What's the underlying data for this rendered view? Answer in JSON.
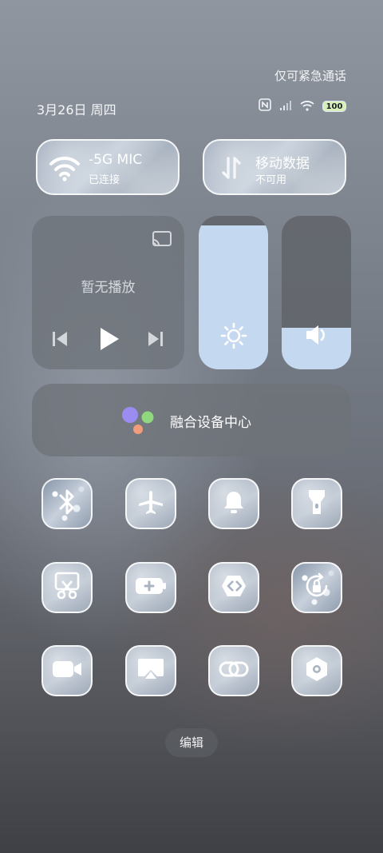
{
  "status_bar": {
    "emergency_text": "仅可紧急通话",
    "date_text": "3月26日 周四",
    "battery_level": "100",
    "icons": [
      "nfc-icon",
      "signal-icon",
      "wifi-icon",
      "battery-icon"
    ]
  },
  "connectivity": {
    "wifi": {
      "title": "-5G   MIC",
      "subtitle": "已连接",
      "icon": "wifi-icon"
    },
    "mobile_data": {
      "title": "移动数据",
      "subtitle": "不可用",
      "icon": "mobile-data-icon"
    }
  },
  "media": {
    "status_text": "暂无播放",
    "icons": [
      "cast-icon",
      "previous-icon",
      "play-icon",
      "next-icon"
    ]
  },
  "brightness": {
    "level": 0.94,
    "icon": "sun-icon"
  },
  "volume": {
    "level": 0.27,
    "icon": "speaker-icon"
  },
  "device_hub": {
    "label": "融合设备中心",
    "icon": "hub-dots-icon"
  },
  "tiles": [
    {
      "icon": "bluetooth-icon",
      "style": "pattern"
    },
    {
      "icon": "airplane-icon",
      "style": "plain"
    },
    {
      "icon": "bell-icon",
      "style": "plain"
    },
    {
      "icon": "flashlight-icon",
      "style": "plain"
    },
    {
      "icon": "screenshot-scissors-icon",
      "style": "plain"
    },
    {
      "icon": "battery-saver-icon",
      "style": "plain"
    },
    {
      "icon": "nearby-share-icon",
      "style": "plain"
    },
    {
      "icon": "rotation-lock-icon",
      "style": "pattern"
    },
    {
      "icon": "video-camera-icon",
      "style": "plain"
    },
    {
      "icon": "screen-cast-icon",
      "style": "plain"
    },
    {
      "icon": "link-icon",
      "style": "plain"
    },
    {
      "icon": "settings-hex-icon",
      "style": "plain"
    }
  ],
  "edit_label": "编辑",
  "colors": {
    "slider_fill": "#c4d8f0",
    "battery_fill": "#d8f0b8"
  }
}
